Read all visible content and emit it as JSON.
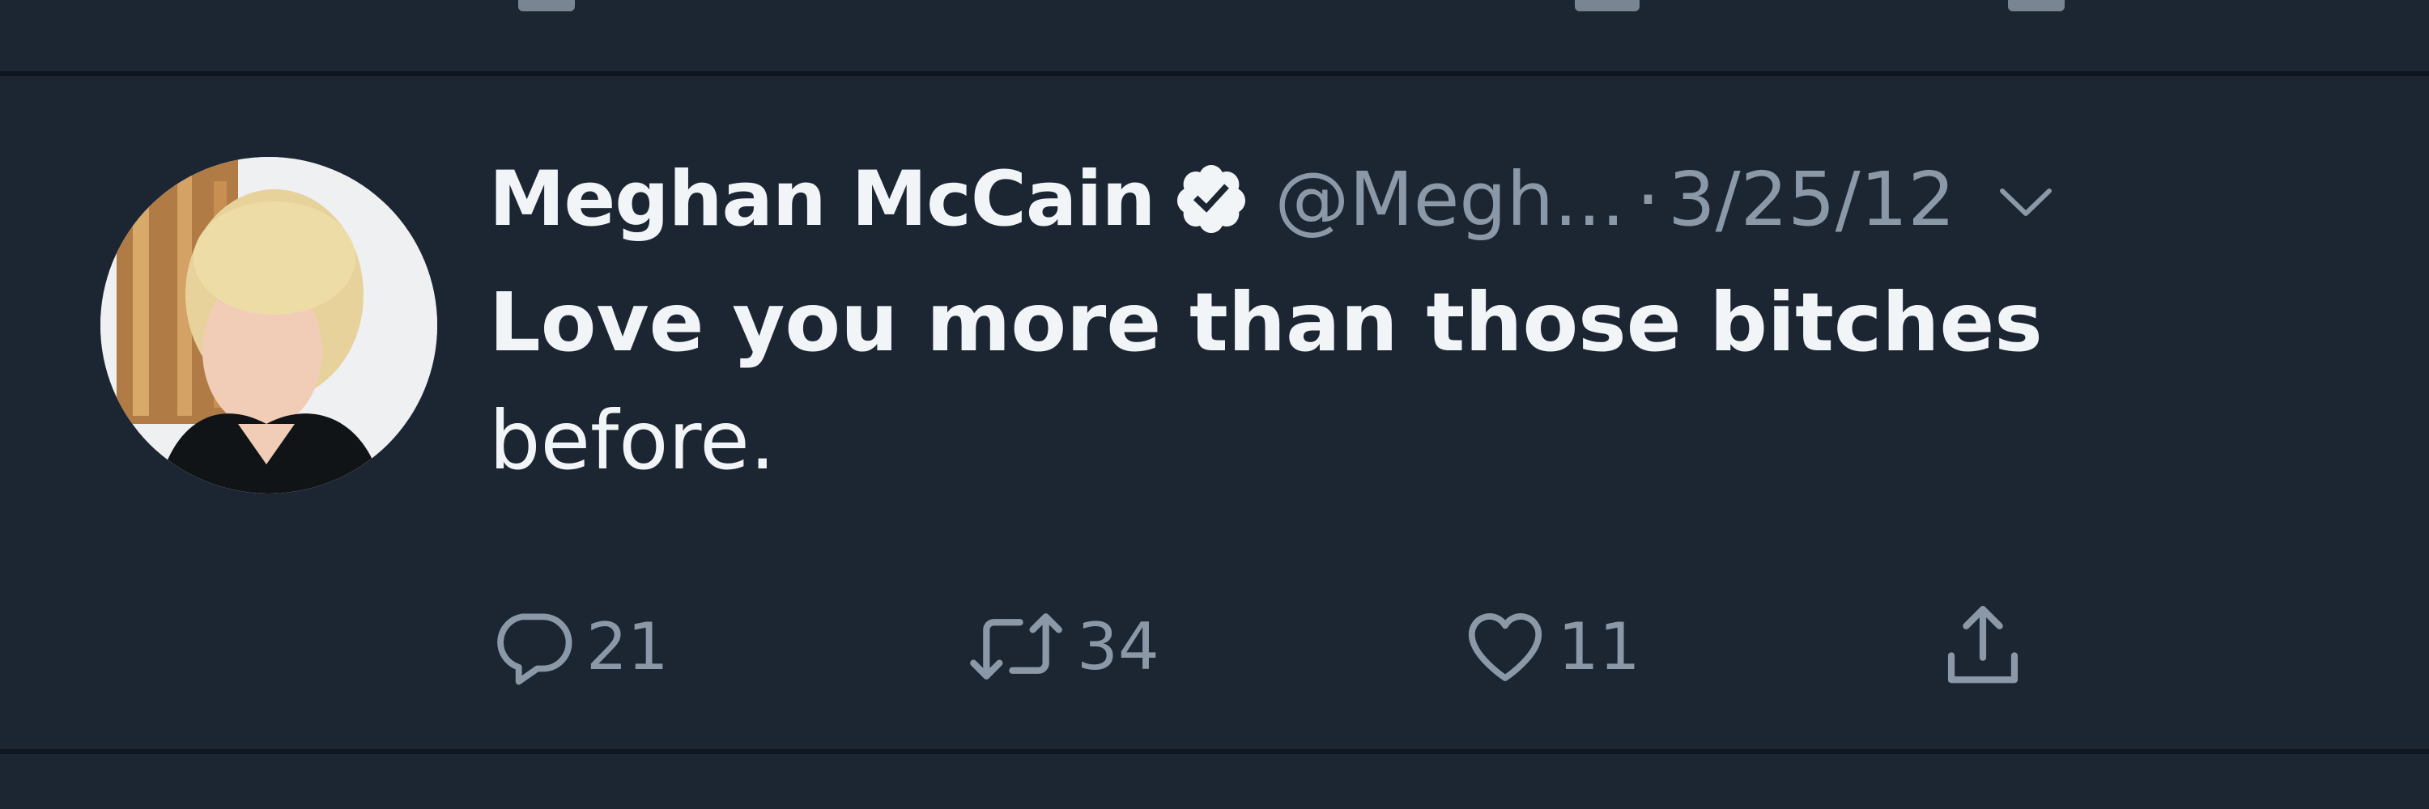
{
  "tweet": {
    "author": {
      "name": "Meghan McCain",
      "handle": "@Megh...",
      "verified": true,
      "avatar_icon": "avatar"
    },
    "separator": "·",
    "date": "3/25/12",
    "text_line1": "Love you more than those bitches",
    "text_line2": "before.",
    "actions": {
      "reply": {
        "icon": "reply-icon",
        "count": "21"
      },
      "retweet": {
        "icon": "retweet-icon",
        "count": "34"
      },
      "like": {
        "icon": "heart-icon",
        "count": "11"
      },
      "share": {
        "icon": "share-icon"
      }
    }
  },
  "colors": {
    "background": "#1c2632",
    "divider": "#0f1620",
    "primary_text": "#f2f5f8",
    "secondary_text": "#8b98a7"
  }
}
